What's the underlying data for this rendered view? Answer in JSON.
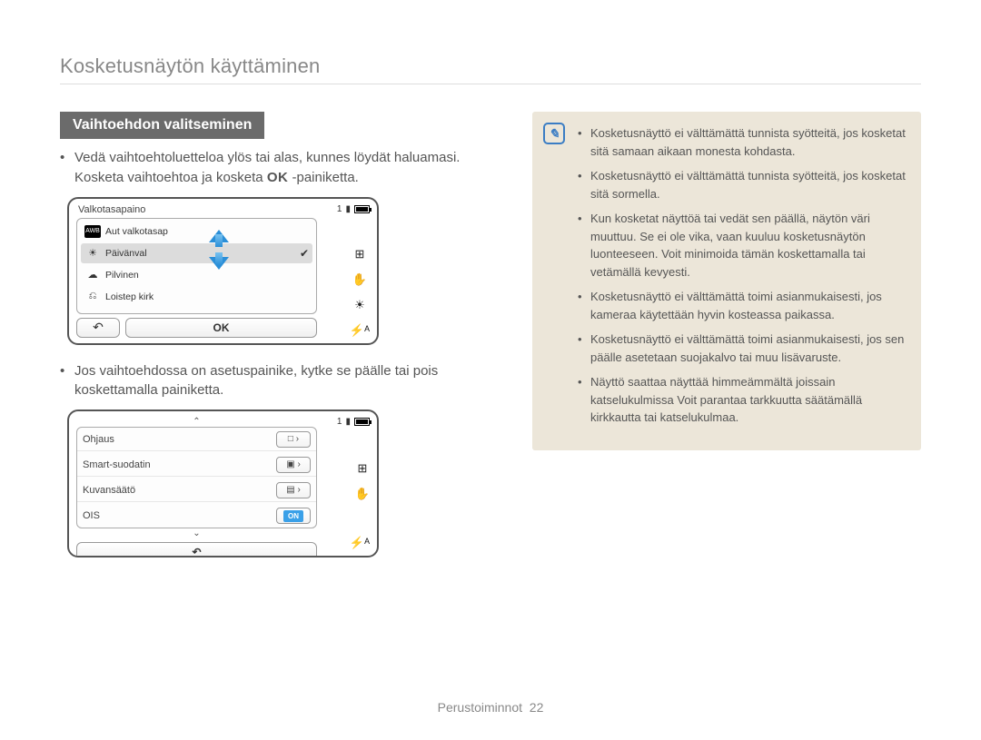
{
  "header": "Kosketusnäytön käyttäminen",
  "section_heading": "Vaihtoehdon valitseminen",
  "bullet1_pre": "Vedä vaihtoehtoluetteloa ylös tai alas, kunnes löydät haluamasi. Kosketa vaihtoehtoa ja kosketa ",
  "bullet1_ok": "OK",
  "bullet1_post": " -painiketta.",
  "bullet2": "Jos vaihtoehdossa on asetuspainike, kytke se päälle tai pois koskettamalla painiketta.",
  "fig1": {
    "title": "Valkotasapaino",
    "items": [
      {
        "icon": "AWB",
        "label": "Aut valkotasap"
      },
      {
        "icon": "☀",
        "label": "Päivänval"
      },
      {
        "icon": "☁",
        "label": "Pilvinen"
      },
      {
        "icon": "⎌",
        "label": "Loistep kirk"
      }
    ],
    "selected_index": 1,
    "back": "↶",
    "ok": "OK",
    "counter": "1",
    "side_icons": [
      "⊞",
      "✋",
      "☀",
      "⚡ᴬ"
    ]
  },
  "fig2": {
    "rows": [
      {
        "label": "Ohjaus",
        "ctrl": "□ ›"
      },
      {
        "label": "Smart-suodatin",
        "ctrl": "▣ ›"
      },
      {
        "label": "Kuvansäätö",
        "ctrl": "▤ ›"
      },
      {
        "label": "OIS",
        "on": "ON"
      }
    ],
    "back": "↶",
    "counter": "1",
    "side_icons": [
      "⊞",
      "✋",
      "⚡ᴬ"
    ]
  },
  "note": {
    "items": [
      "Kosketusnäyttö ei välttämättä tunnista syötteitä, jos kosketat sitä samaan aikaan monesta kohdasta.",
      "Kosketusnäyttö ei välttämättä tunnista syötteitä, jos kosketat sitä sormella.",
      "Kun kosketat näyttöä tai vedät sen päällä, näytön väri muuttuu. Se ei ole vika, vaan kuuluu kosketusnäytön luonteeseen. Voit minimoida tämän koskettamalla tai vetämällä kevyesti.",
      "Kosketusnäyttö ei välttämättä toimi asianmukaisesti, jos kameraa käytettään hyvin kosteassa paikassa.",
      "Kosketusnäyttö ei välttämättä toimi asianmukaisesti, jos sen päälle asetetaan suojakalvo tai muu lisävaruste.",
      "Näyttö saattaa näyttää himmeämmältä joissain katselukulmissa Voit parantaa tarkkuutta säätämällä kirkkautta tai katselukulmaa."
    ]
  },
  "footer": {
    "label": "Perustoiminnot",
    "page": "22"
  }
}
